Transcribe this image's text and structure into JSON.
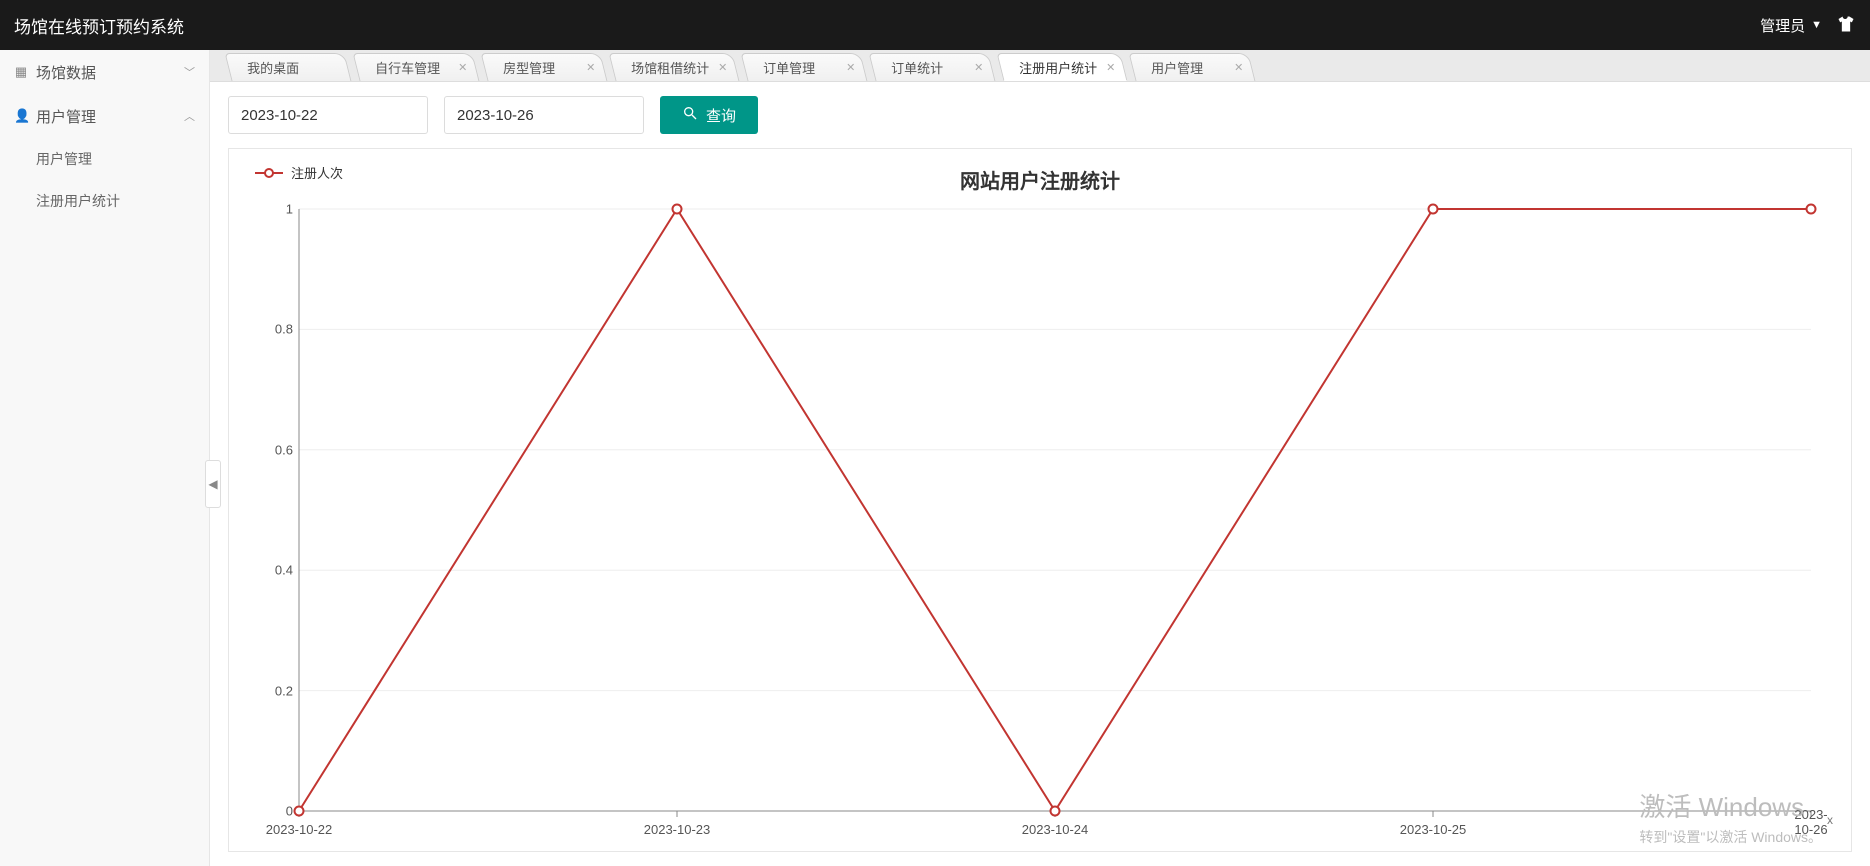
{
  "header": {
    "app_title": "场馆在线预订预约系统",
    "admin_label": "管理员"
  },
  "sidebar": {
    "groups": [
      {
        "icon": "grid",
        "label": "场馆数据",
        "expanded": false,
        "items": []
      },
      {
        "icon": "user",
        "label": "用户管理",
        "expanded": true,
        "items": [
          {
            "label": "用户管理"
          },
          {
            "label": "注册用户统计"
          }
        ]
      }
    ]
  },
  "tabs": {
    "items": [
      {
        "label": "我的桌面",
        "closable": false,
        "active": false
      },
      {
        "label": "自行车管理",
        "closable": true,
        "active": false
      },
      {
        "label": "房型管理",
        "closable": true,
        "active": false
      },
      {
        "label": "场馆租借统计",
        "closable": true,
        "active": false
      },
      {
        "label": "订单管理",
        "closable": true,
        "active": false
      },
      {
        "label": "订单统计",
        "closable": true,
        "active": false
      },
      {
        "label": "注册用户统计",
        "closable": true,
        "active": true
      },
      {
        "label": "用户管理",
        "closable": true,
        "active": false
      }
    ]
  },
  "filter": {
    "date_from": "2023-10-22",
    "date_to": "2023-10-26",
    "query_label": "查询"
  },
  "chart_data": {
    "type": "line",
    "title": "网站用户注册统计",
    "series": [
      {
        "name": "注册人次",
        "values": [
          0,
          1,
          0,
          1,
          1
        ],
        "color": "#c23531"
      }
    ],
    "categories": [
      "2023-10-22",
      "2023-10-23",
      "2023-10-24",
      "2023-10-25",
      "2023-10-26"
    ],
    "xlabel": "x",
    "ylabel": "",
    "ylim": [
      0,
      1
    ],
    "y_ticks": [
      0,
      0.2,
      0.4,
      0.6,
      0.8,
      1
    ]
  },
  "watermark": {
    "line1": "激活 Windows",
    "line2": "转到\"设置\"以激活 Windows。"
  }
}
